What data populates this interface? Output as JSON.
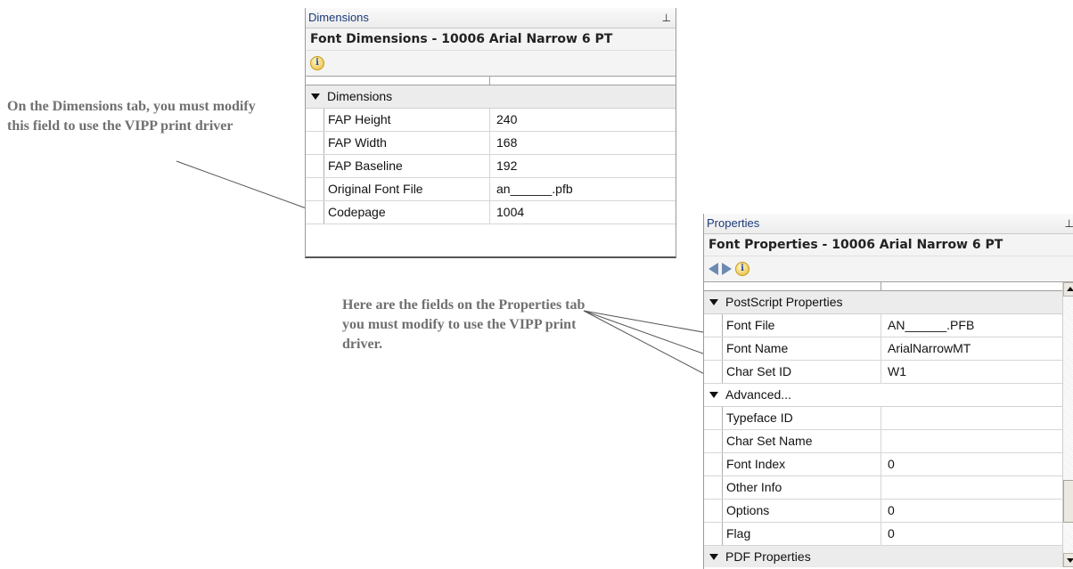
{
  "callouts": {
    "dimensions_note": "On the Dimensions tab, you must modify this field to use the VIPP print driver",
    "properties_note": "Here are the fields on the Properties tab you must modify to use the VIPP print driver."
  },
  "dimensions_panel": {
    "title": "Dimensions",
    "pin": "⊥",
    "header": "Font Dimensions - 10006  Arial Narrow 6 PT",
    "category": "Dimensions",
    "rows": [
      {
        "name": "FAP Height",
        "value": "240"
      },
      {
        "name": "FAP Width",
        "value": "168"
      },
      {
        "name": "FAP Baseline",
        "value": "192"
      },
      {
        "name": "Original Font File",
        "value": "an______.pfb"
      },
      {
        "name": "Codepage",
        "value": "1004"
      }
    ]
  },
  "properties_panel": {
    "title": "Properties",
    "pin": "⊥",
    "header": "Font Properties - 10006  Arial Narrow 6 PT",
    "postscript_category": "PostScript Properties",
    "postscript_rows": [
      {
        "name": "Font File",
        "value": "AN______.PFB"
      },
      {
        "name": "Font Name",
        "value": "ArialNarrowMT"
      },
      {
        "name": "Char Set ID",
        "value": "W1"
      }
    ],
    "advanced_category": "Advanced...",
    "advanced_rows": [
      {
        "name": "Typeface ID",
        "value": ""
      },
      {
        "name": "Char Set Name",
        "value": ""
      },
      {
        "name": "Font Index",
        "value": "0"
      },
      {
        "name": "Other Info",
        "value": ""
      },
      {
        "name": "Options",
        "value": "0"
      },
      {
        "name": "Flag",
        "value": "0"
      }
    ],
    "pdf_category": "PDF Properties"
  },
  "icons": {
    "info": "info-icon",
    "back": "back-arrow-icon",
    "forward": "forward-arrow-icon",
    "pin": "pin-icon",
    "expand": "collapse-triangle-icon"
  }
}
